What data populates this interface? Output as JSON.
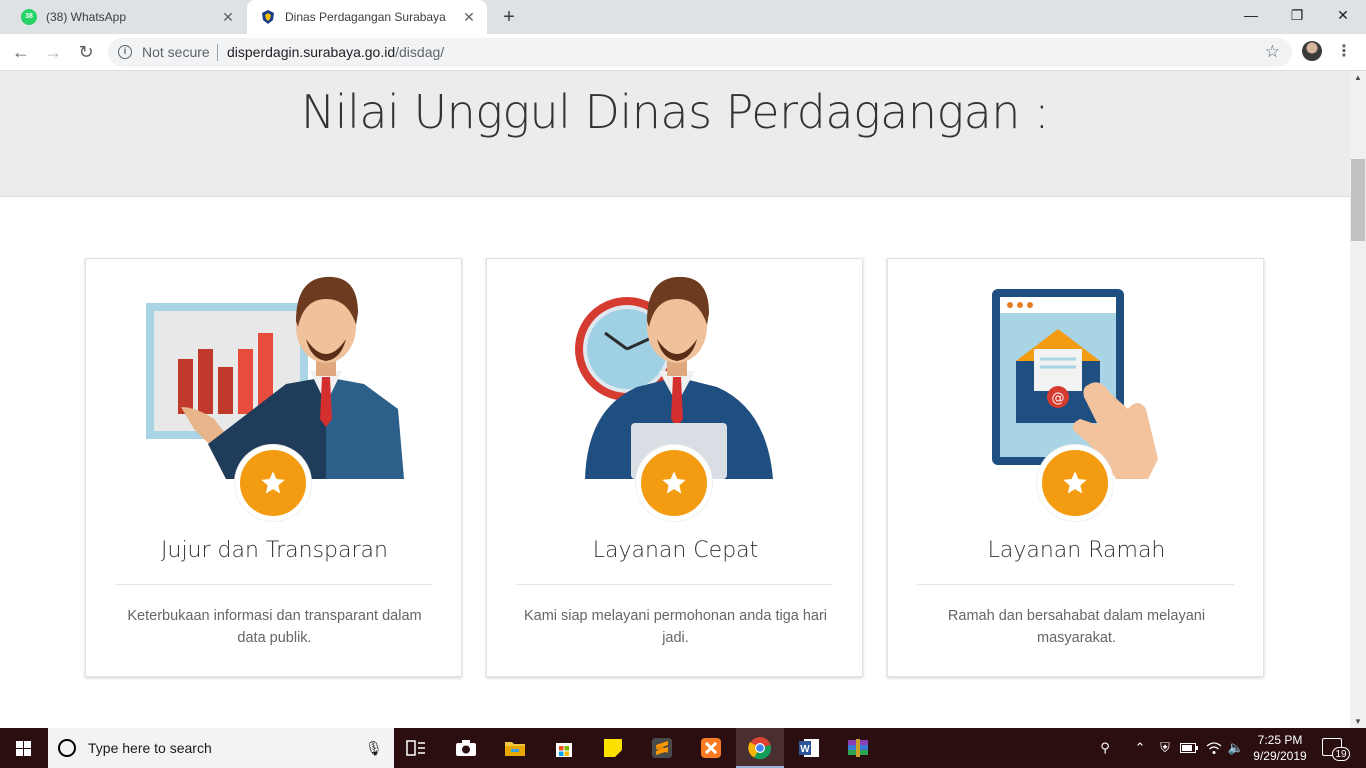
{
  "browser": {
    "tabs": [
      {
        "title": "(38) WhatsApp",
        "badge": "38",
        "icon": "whatsapp-icon"
      },
      {
        "title": "Dinas Perdagangan Surabaya",
        "icon": "surabaya-crest-icon"
      }
    ],
    "omnibox": {
      "security": "Not secure",
      "host": "disperdagin.surabaya.go.id",
      "path": "/disdag/"
    }
  },
  "page": {
    "heading": "Nilai Unggul Dinas Perdagangan :",
    "cards": [
      {
        "title": "Jujur dan Transparan",
        "desc": "Keterbukaan informasi dan transparant dalam data publik.",
        "illustration": "presenter-chart-illustration"
      },
      {
        "title": "Layanan Cepat",
        "desc": "Kami siap melayani permohonan anda tiga hari jadi.",
        "illustration": "businessman-clock-illustration"
      },
      {
        "title": "Layanan Ramah",
        "desc": "Ramah dan bersahabat dalam melayani masyarakat.",
        "illustration": "tablet-email-illustration"
      }
    ],
    "accent_color": "#f39c12"
  },
  "taskbar": {
    "search_placeholder": "Type here to search",
    "time": "7:25 PM",
    "date": "9/29/2019",
    "notifications": "19"
  }
}
